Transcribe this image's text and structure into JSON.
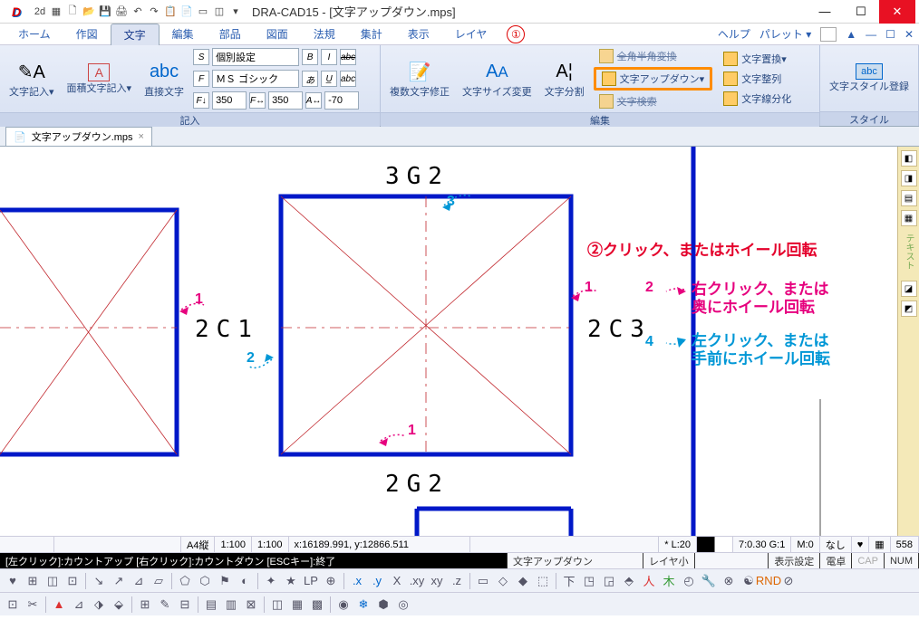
{
  "title": "DRA-CAD15 - [文字アップダウン.mps]",
  "tabs": [
    "ホーム",
    "作図",
    "文字",
    "編集",
    "部品",
    "図面",
    "法規",
    "集計",
    "表示",
    "レイヤ"
  ],
  "activeTab": 2,
  "circ1": "①",
  "help": "ヘルプ",
  "palette": "パレット ▾",
  "ribbon": {
    "g1": {
      "b1": "文字記入▾",
      "b2": "面積文字記入▾",
      "b3": "直接文字",
      "lbl": "記入"
    },
    "g2": {
      "style_chip": "S",
      "style_combo": "個別設定",
      "font_chip": "F",
      "font_combo": "ＭＳ ゴシック",
      "w_chip": "F↓",
      "w_val": "350",
      "h_chip": "F↔",
      "h_val": "350",
      "sp_chip": "A↔",
      "sp_val": "-70",
      "icons": [
        "B",
        "I",
        "U",
        "abc",
        "あ",
        "U̲",
        "abc"
      ]
    },
    "g3": {
      "b1": "複数文字修正",
      "b2": "文字サイズ変更",
      "b3": "文字分割",
      "lbl": "編集",
      "r1": "全角半角変換",
      "r2": "文字アップダウン▾",
      "r3": "文字検索",
      "r4": "文字置換▾",
      "r5": "文字整列",
      "r6": "文字線分化"
    },
    "g4": {
      "b1": "文字スタイル登録",
      "lbl": "スタイル"
    }
  },
  "doctab": {
    "name": "文字アップダウン.mps",
    "close": "×"
  },
  "canvasLabels": {
    "l3g2": "3G2",
    "l2c1": "2C1",
    "l2c3": "2C3",
    "l2g2": "2G2"
  },
  "markers": {
    "m1": "1",
    "m2": "2",
    "m3": "3",
    "m4": "4"
  },
  "annotations": {
    "a2": "②クリック、またはホイール回転",
    "a_r1": "右クリック、または",
    "a_r2": "奥にホイール回転",
    "a_l1": "左クリック、または",
    "a_l2": "手前にホイール回転"
  },
  "status1": {
    "paper": "A4縦",
    "scale1": "1:100",
    "scale2": "1:100",
    "coords": "x:16189.991, y:12866.511",
    "layer": "* L:20",
    "grp": "7:0.30 G:1",
    "m": "M:0",
    "none": "なし",
    "pt": "558"
  },
  "status2": {
    "hint": "[左クリック]:カウントアップ [右クリック]:カウントダウン [ESCキー]:終了",
    "mode": "文字アップダウン",
    "layerSmall": "レイヤ小",
    "disp": "表示設定",
    "calc": "電卓",
    "cap": "CAP",
    "num": "NUM"
  },
  "sideLabel": "テキスト"
}
